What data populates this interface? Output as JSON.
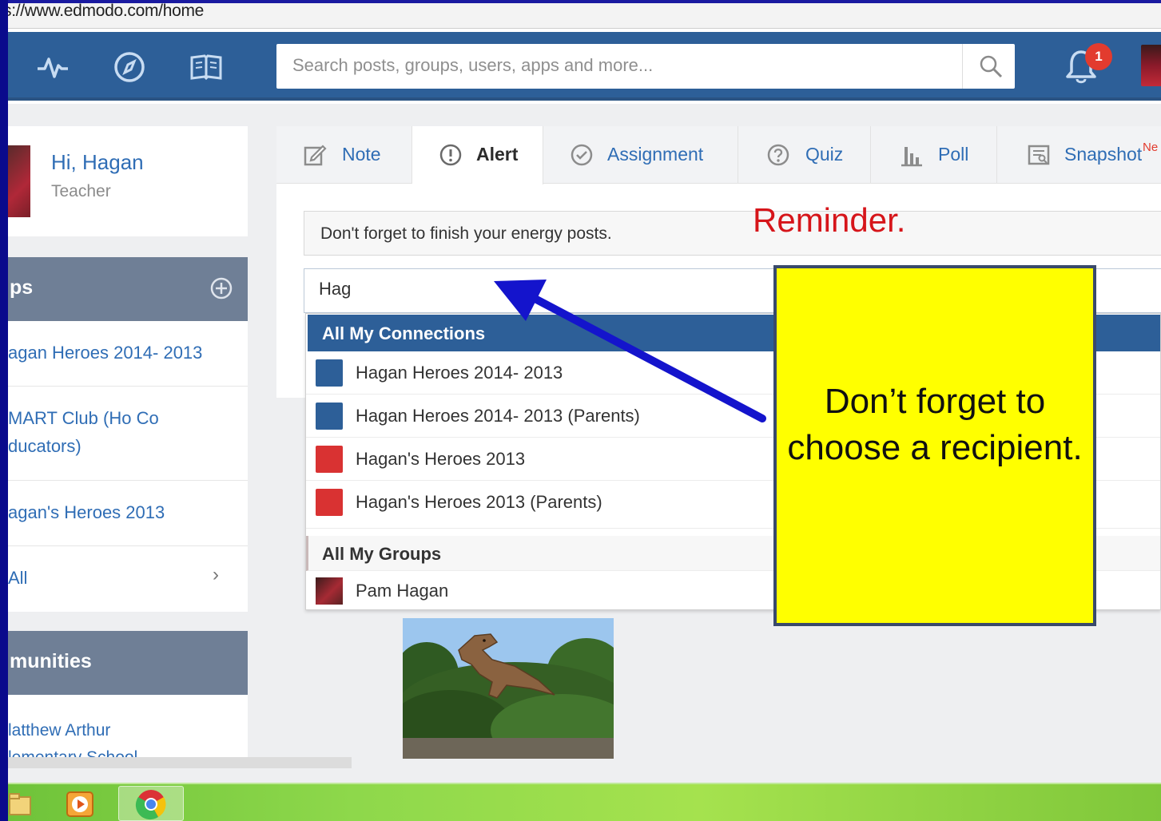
{
  "browser": {
    "url": "s://www.edmodo.com/home"
  },
  "topbar": {
    "icons": [
      "activity-icon",
      "compass-icon",
      "book-icon"
    ],
    "search_placeholder": "Search posts, groups, users, apps and more...",
    "notification_count": "1"
  },
  "profile": {
    "greeting": "Hi, Hagan",
    "role": "Teacher"
  },
  "groups": {
    "title": "ps",
    "items": [
      {
        "label": "agan Heroes 2014- 2013"
      },
      {
        "label": "MART Club (Ho Co\nducators)"
      },
      {
        "label": "agan's Heroes 2013"
      },
      {
        "label": "All"
      }
    ]
  },
  "communities": {
    "title": "munities",
    "item": "latthew Arthur\nlementary School"
  },
  "composer": {
    "tabs": [
      {
        "label": "Note"
      },
      {
        "label": "Alert"
      },
      {
        "label": "Assignment"
      },
      {
        "label": "Quiz"
      },
      {
        "label": "Poll"
      },
      {
        "label": "Snapshot"
      }
    ],
    "snapshot_badge": "Ne",
    "message": "Don't forget to finish your energy posts.",
    "recipient_value": "Hag"
  },
  "dropdown": {
    "connections_header": "All My Connections",
    "connections": [
      {
        "label": "Hagan Heroes 2014- 2013",
        "color": "#2d5f98"
      },
      {
        "label": "Hagan Heroes 2014- 2013 (Parents)",
        "color": "#2d5f98"
      },
      {
        "label": "Hagan's Heroes 2013",
        "color": "#d93232"
      },
      {
        "label": "Hagan's Heroes 2013 (Parents)",
        "color": "#d93232"
      }
    ],
    "groups_header": "All My Groups",
    "groups": [
      {
        "label": "Pam Hagan"
      }
    ]
  },
  "annotations": {
    "reminder": "Reminder.",
    "callout": "Don’t forget to choose a recipient."
  },
  "colors": {
    "edmodo_blue": "#2d5f98",
    "link_blue": "#2f6db5",
    "callout_yellow": "#ffff00",
    "annotation_red": "#d6151a",
    "arrow_blue": "#1414cc"
  }
}
